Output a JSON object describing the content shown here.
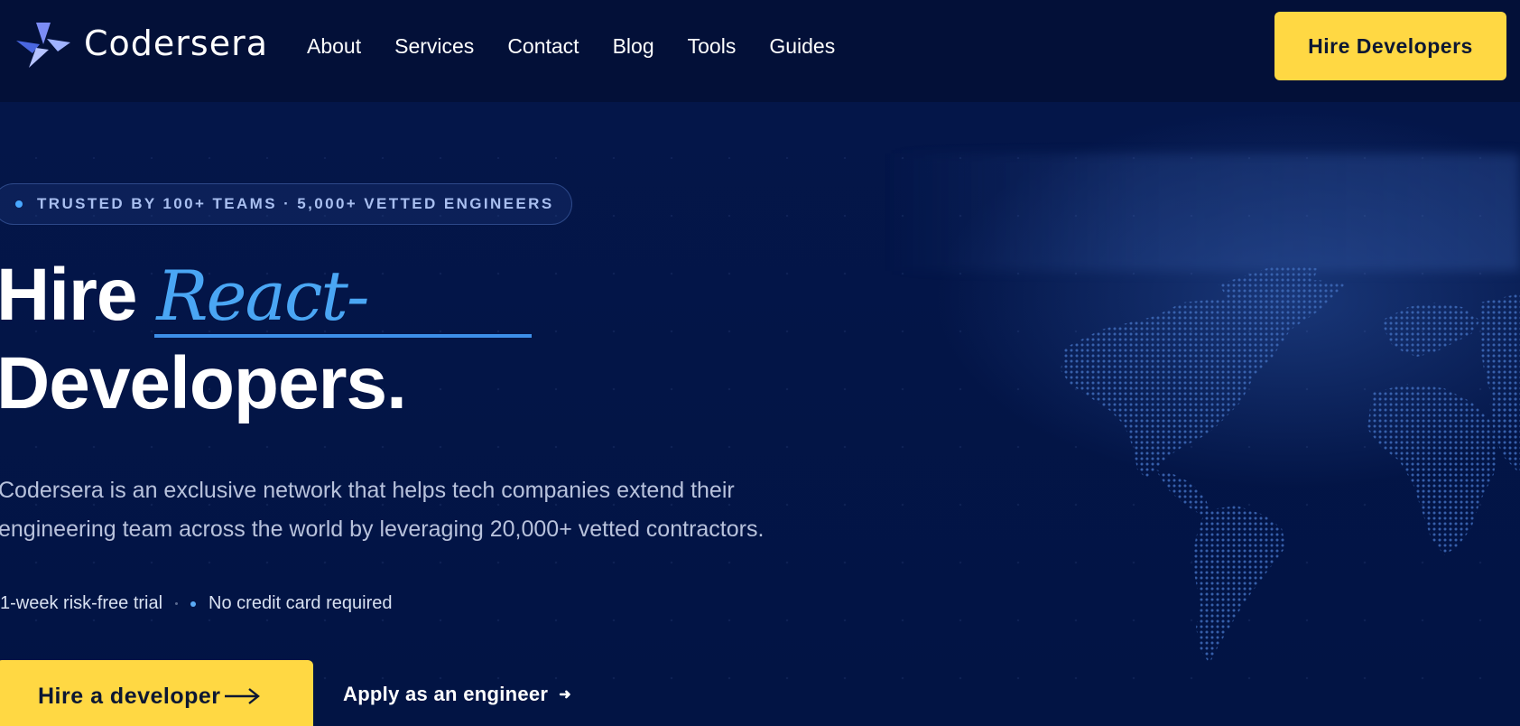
{
  "header": {
    "brand": "Codersera",
    "nav": [
      "About",
      "Services",
      "Contact",
      "Blog",
      "Tools",
      "Guides"
    ],
    "hire_button": "Hire Developers"
  },
  "hero": {
    "badge": "TRUSTED BY 100+ TEAMS · 5,000+ VETTED ENGINEERS",
    "headline_prefix": "Hire",
    "headline_accent": "React-",
    "headline_line2": "Developers.",
    "description": "Codersera is an exclusive network that helps tech companies extend their engineering team across the world by leveraging 20,000+ vetted contractors.",
    "bullets": [
      "1-week risk-free trial",
      "No credit card required"
    ],
    "cta_primary": "Hire a developer",
    "cta_secondary": "Apply as an engineer"
  },
  "colors": {
    "background": "#02123f",
    "header": "#031038",
    "accent_yellow": "#ffd843",
    "accent_blue": "#4aa6f4"
  },
  "icons": {
    "logo": "codersera-logo-icon",
    "cta_arrow": "arrow-right-icon",
    "apply_arrow": "small-arrow-right-icon",
    "map": "dotted-world-map"
  }
}
